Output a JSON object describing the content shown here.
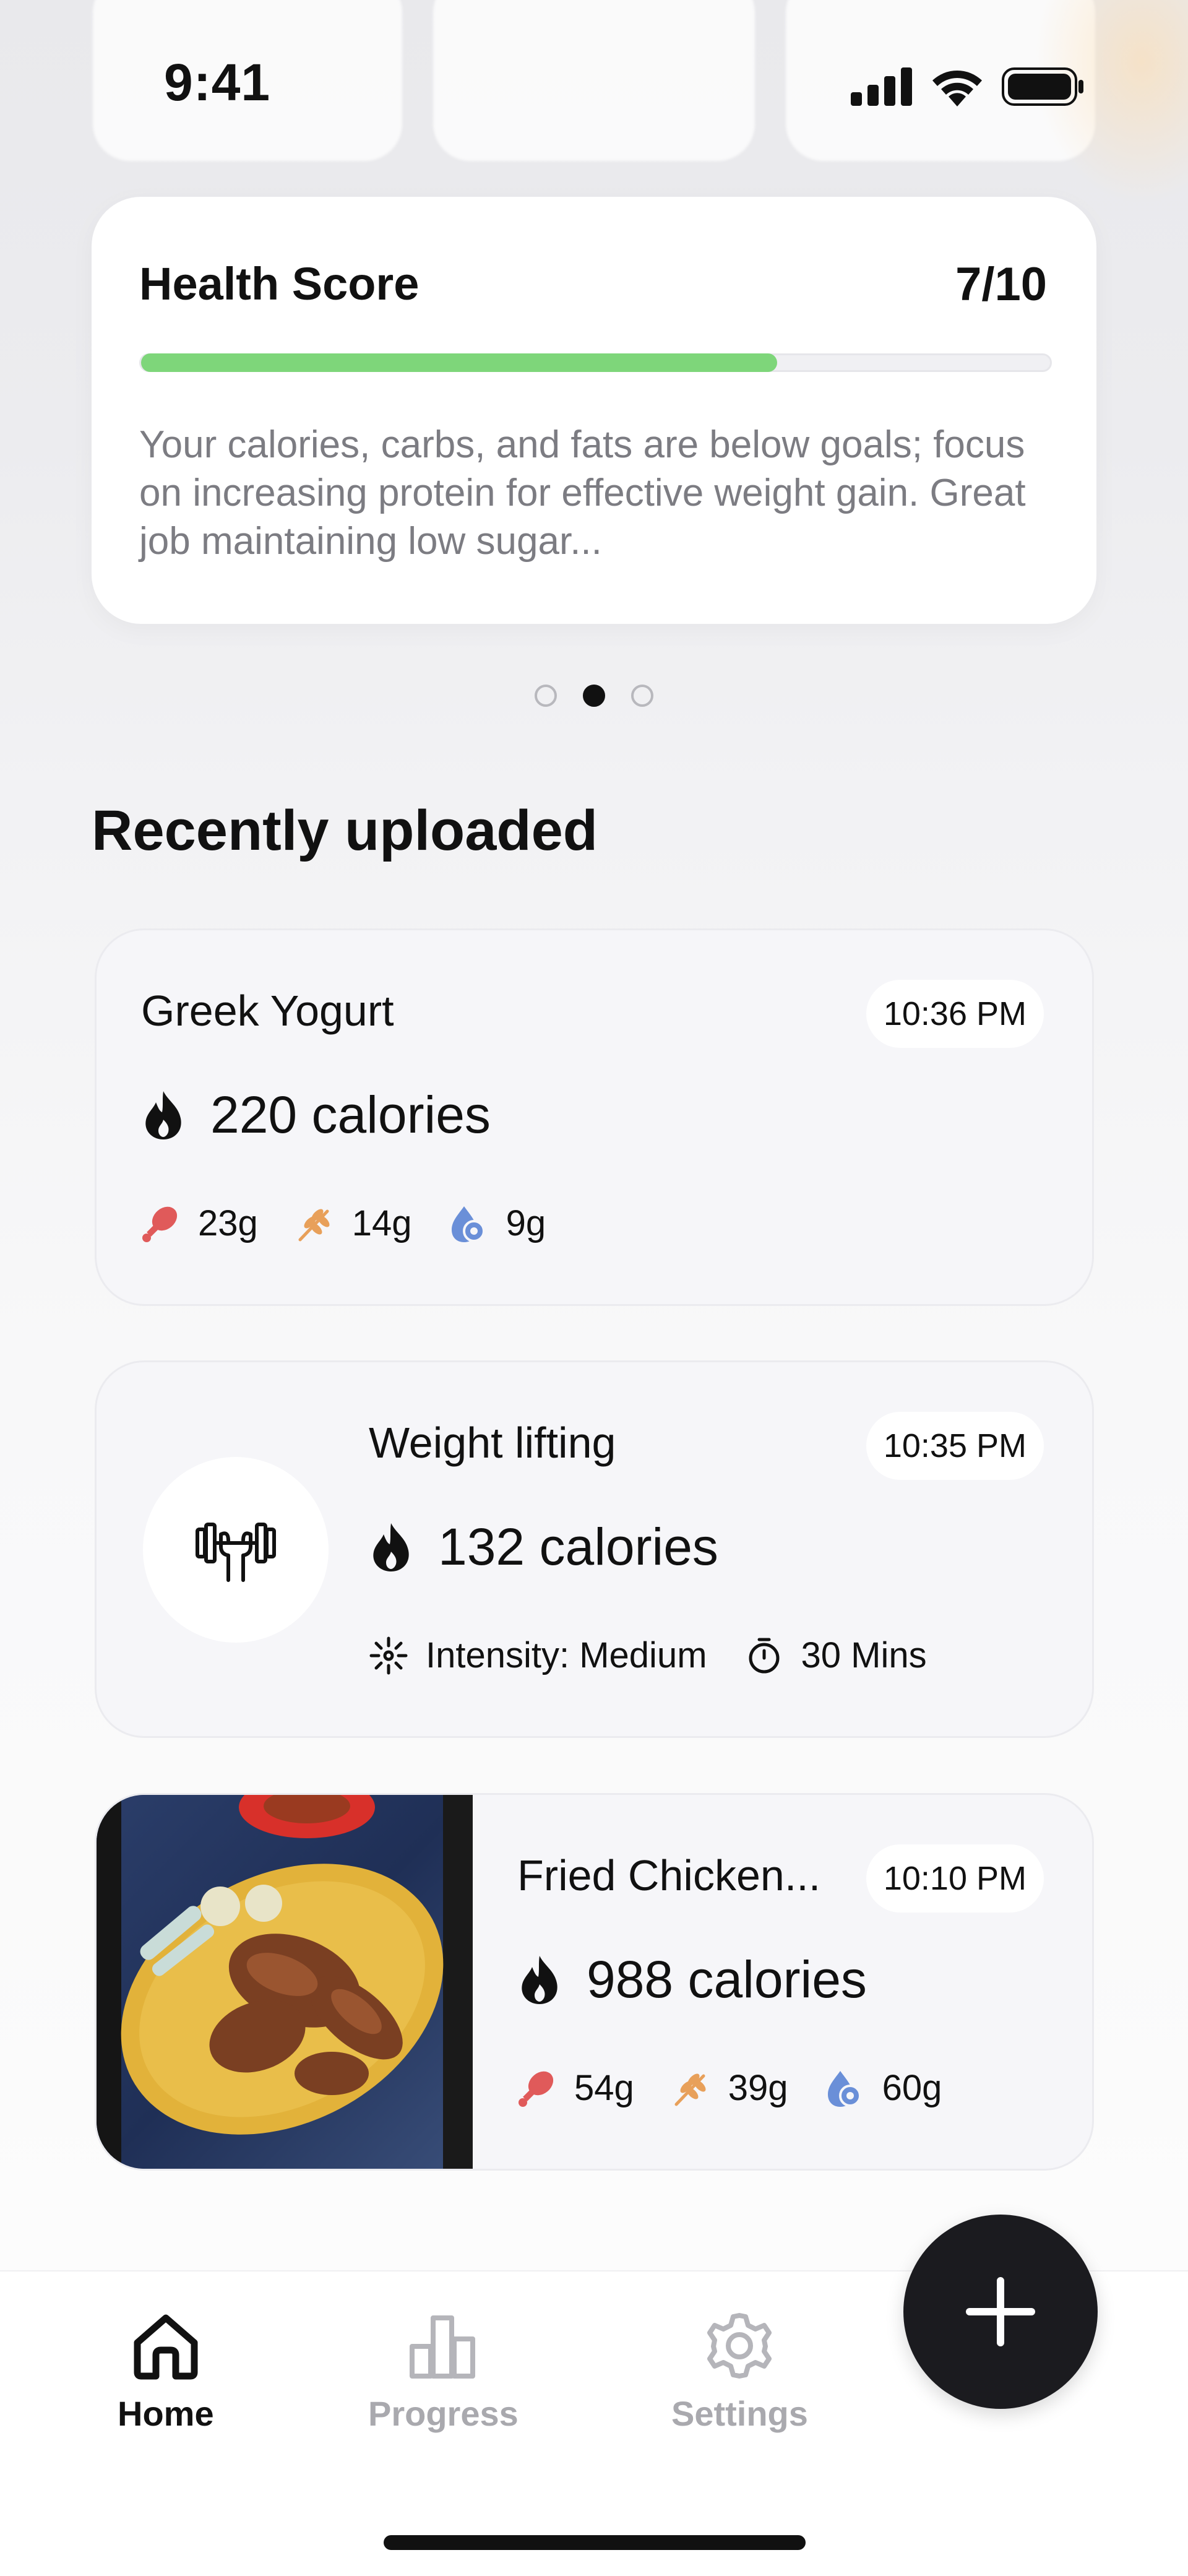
{
  "status_bar": {
    "time": "9:41"
  },
  "health_score": {
    "title": "Health Score",
    "value": "7/10",
    "progress": 0.7,
    "description": "Your calories, carbs, and fats are below goals; focus on increasing protein for effective weight gain. Great job maintaining low sugar..."
  },
  "pager": {
    "count": 3,
    "active_index": 1
  },
  "section_title": "Recently uploaded",
  "entries": [
    {
      "name": "Greek Yogurt",
      "time": "10:36 PM",
      "calories": "220 calories",
      "protein": "23g",
      "carbs": "14g",
      "fat": "9g"
    },
    {
      "name": "Weight lifting",
      "time": "10:35 PM",
      "calories": "132 calories",
      "intensity": "Intensity: Medium",
      "duration": "30 Mins"
    },
    {
      "name": "Fried Chicken...",
      "time": "10:10 PM",
      "calories": "988 calories",
      "protein": "54g",
      "carbs": "39g",
      "fat": "60g"
    }
  ],
  "nav": {
    "home": "Home",
    "progress": "Progress",
    "settings": "Settings"
  },
  "colors": {
    "accent_green": "#7ed67a",
    "protein": "#e05a5a",
    "carbs": "#e8a05a",
    "fat": "#6a8fd8",
    "fab": "#1b1b1f"
  }
}
